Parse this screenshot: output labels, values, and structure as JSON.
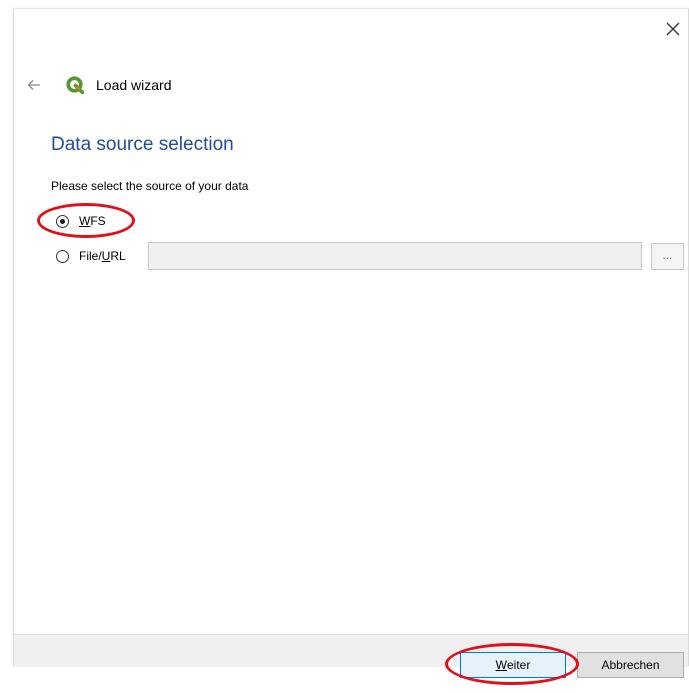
{
  "wizard": {
    "title": "Load wizard",
    "page_title": "Data source selection",
    "prompt": "Please select the source of your data"
  },
  "source_options": [
    {
      "label_before": "",
      "label_mnemonic": "W",
      "label_after": "FS",
      "checked": true
    },
    {
      "label_before": "File/",
      "label_mnemonic": "U",
      "label_after": "RL",
      "checked": false
    }
  ],
  "file_url_input": {
    "value": "",
    "placeholder": ""
  },
  "browse_label": "...",
  "buttons": {
    "next_mnemonic": "W",
    "next_rest": "eiter",
    "cancel": "Abbrechen"
  },
  "icons": {
    "close": "close-icon",
    "back": "back-arrow-icon",
    "app": "qgis-logo-icon"
  },
  "colors": {
    "title_blue": "#1f4e9a",
    "annotation_red": "#e0101a",
    "logo_green": "#589632",
    "logo_yellow": "#ee7913"
  }
}
